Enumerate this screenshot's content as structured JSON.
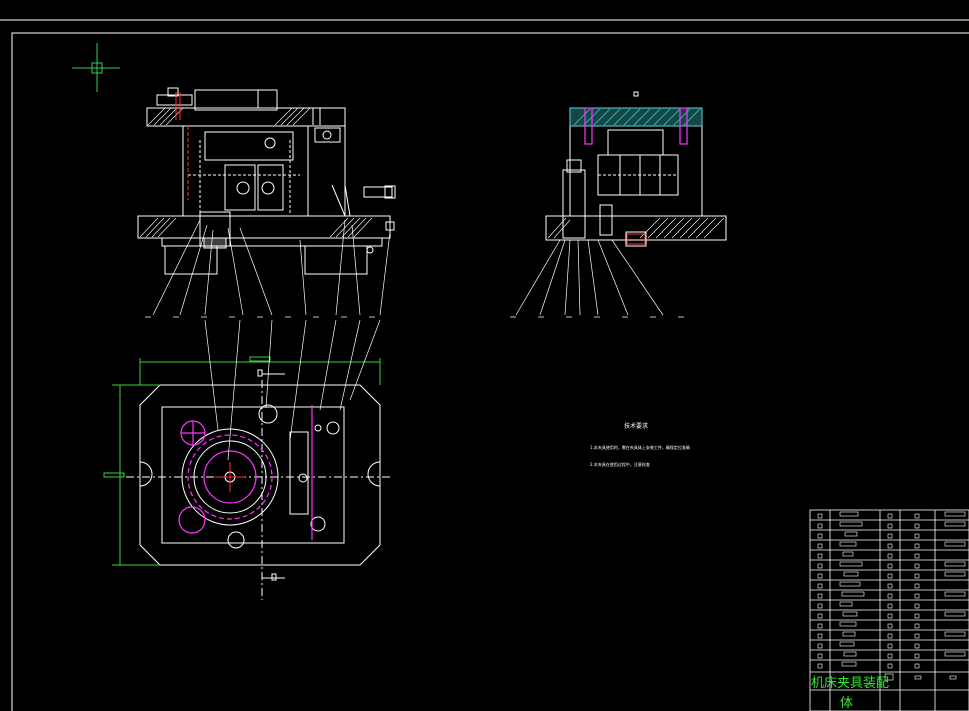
{
  "drawing": {
    "notes_title": "技术要求",
    "note_1": "1.本夹具使用时，需在夹具体上安装工件，确保定位准确",
    "note_2": "2.本夹具在使用过程中，注意检查",
    "title_block_name": "机床夹具装配",
    "title_block_sub": "体"
  },
  "colors": {
    "background": "#000000",
    "line": "#ffffff",
    "magenta": "#ff33ff",
    "hatch_cyan": "#40c8c8",
    "green": "#3ad23a",
    "red": "#ff3030"
  },
  "icons": {
    "crosshair": "cad-cursor-crosshair-icon"
  }
}
